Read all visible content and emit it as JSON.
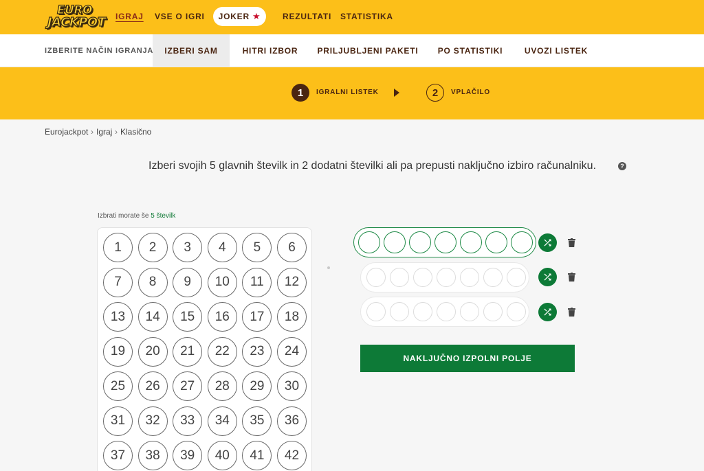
{
  "brand": {
    "logo_line1": "EURO",
    "logo_line2": "JACKPOT"
  },
  "nav": {
    "items": [
      {
        "label": "IGRAJ"
      },
      {
        "label": "VSE O IGRI"
      },
      {
        "label": "JOKER"
      },
      {
        "label": "REZULTATI"
      },
      {
        "label": "STATISTIKA"
      }
    ],
    "active": "IGRAJ"
  },
  "mode_bar": {
    "label": "IZBERITE NAČIN IGRANJA:",
    "tabs": [
      {
        "label": "IZBERI SAM"
      },
      {
        "label": "HITRI IZBOR"
      },
      {
        "label": "PRILJUBLJENI PAKETI"
      },
      {
        "label": "PO STATISTIKI"
      },
      {
        "label": "UVOZI LISTEK"
      }
    ],
    "active_tab": "IZBERI SAM"
  },
  "steps": [
    {
      "number": "1",
      "label": "IGRALNI LISTEK",
      "active": true
    },
    {
      "number": "2",
      "label": "VPLAČILO",
      "active": false
    }
  ],
  "breadcrumb": [
    "Eurojackpot",
    "Igraj",
    "Klasično"
  ],
  "instruction": "Izberi svojih 5 glavnih številk in 2 dodatni številki ali pa prepusti naključno izbiro računalniku.",
  "remaining": {
    "prefix": "Izbrati morate še",
    "highlight": "5 številk"
  },
  "numbers": [
    "1",
    "2",
    "3",
    "4",
    "5",
    "6",
    "7",
    "8",
    "9",
    "10",
    "11",
    "12",
    "13",
    "14",
    "15",
    "16",
    "17",
    "18",
    "19",
    "20",
    "21",
    "22",
    "23",
    "24",
    "25",
    "26",
    "27",
    "28",
    "29",
    "30",
    "31",
    "32",
    "33",
    "34",
    "35",
    "36",
    "37",
    "38",
    "39",
    "40",
    "41",
    "42"
  ],
  "fill_button": "NAKLJUČNO IZPOLNI POLJE",
  "colors": {
    "brand_yellow": "#fcbf19",
    "brand_brown": "#4a2511",
    "action_green": "#0d7a37",
    "joker_star": "#c8102e"
  },
  "icons": [
    "shuffle-icon",
    "trash-icon",
    "help-icon",
    "star-icon",
    "arrow-right-icon"
  ]
}
